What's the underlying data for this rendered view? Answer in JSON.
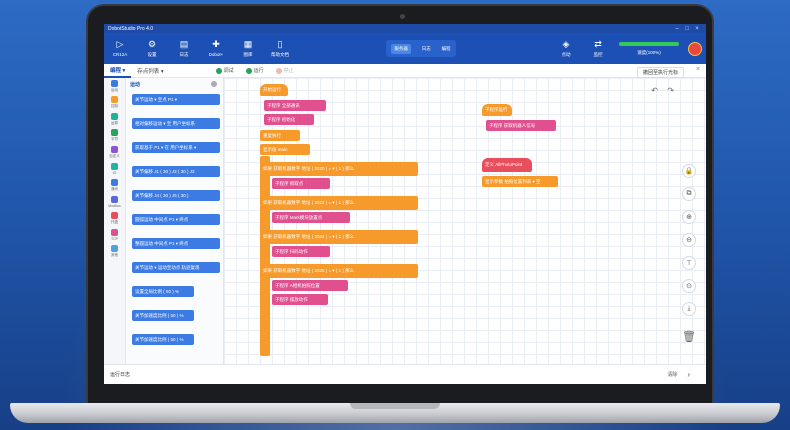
{
  "titlebar": {
    "title": "DobotStudio Pro 4.0",
    "min": "–",
    "max": "□",
    "close": "×"
  },
  "toolbar": {
    "items": [
      {
        "label": "CR12A",
        "icon": "robot-arm-icon",
        "glyph": "▷"
      },
      {
        "label": "设置",
        "icon": "gear-icon",
        "glyph": "⚙"
      },
      {
        "label": "日志",
        "icon": "log-icon",
        "glyph": "▤"
      },
      {
        "label": "Dobot+",
        "icon": "plugin-icon",
        "glyph": "✚"
      },
      {
        "label": "图库",
        "icon": "gallery-icon",
        "glyph": "▦"
      },
      {
        "label": "帮助文档",
        "icon": "document-icon",
        "glyph": "▯"
      }
    ],
    "center": {
      "seg1": "服务器",
      "seg2": "日志",
      "seg3": "编程"
    },
    "right_items": [
      {
        "label": "点动",
        "icon": "jog-icon",
        "glyph": "◈"
      },
      {
        "label": "监控",
        "icon": "monitor-icon",
        "glyph": "⇄"
      }
    ],
    "status": {
      "label": "速度(100%)",
      "speed_fraction": 1.0
    },
    "colors": {
      "bar": "#1d50b5",
      "title": "#1e4aa8"
    }
  },
  "tabs": {
    "items": [
      {
        "label": "编程 ▾",
        "active": true
      },
      {
        "label": "存点列表 ▾",
        "active": false
      }
    ],
    "debug": "调试",
    "run": "运行",
    "stop": "停止",
    "generate": "撤回至执行光标",
    "close": "×"
  },
  "categories": [
    {
      "label": "运动",
      "color": "#3b7be3"
    },
    {
      "label": "控制",
      "color": "#f59a2b"
    },
    {
      "label": "运算",
      "color": "#1fb39a"
    },
    {
      "label": "字符",
      "color": "#27a35b"
    },
    {
      "label": "自定义",
      "color": "#8a56d6"
    },
    {
      "label": "IO",
      "color": "#1fb3a0"
    },
    {
      "label": "通讯",
      "color": "#3b7be3"
    },
    {
      "label": "Modbus",
      "color": "#5a67d8"
    },
    {
      "label": "托盘",
      "color": "#e94e5c"
    },
    {
      "label": "TCP",
      "color": "#e0508e"
    },
    {
      "label": "其他",
      "color": "#4aa3df"
    }
  ],
  "palette": {
    "header": "运动",
    "blocks": [
      {
        "text": "关节运动 ▾  至点  P1 ▾",
        "color": "#3b7be3"
      },
      {
        "text": "相对偏移运动 ▾  至  用户坐标系",
        "color": "#3b7be3"
      },
      {
        "text": "获取基于  P1 ▾  在  用户坐标系 ▾",
        "color": "#3b7be3"
      },
      {
        "text": "关节偏移 J1 ( 30 ) J2 ( 30 ) J3",
        "color": "#3b7be3"
      },
      {
        "text": "关节偏移 J4 ( 30 ) J5 ( 30 )",
        "color": "#3b7be3"
      },
      {
        "text": "圆弧运动 中间点  P1 ▾  终点",
        "color": "#3b7be3"
      },
      {
        "text": "整圆运动 中间点  P1 ▾  终点",
        "color": "#3b7be3"
      },
      {
        "text": "关节运动 ▾  运动至动点 轨迹复现",
        "color": "#3b7be3"
      },
      {
        "text": "设置全局比例 ( 50 ) %",
        "color": "#3b7be3"
      },
      {
        "text": "关节加速度比例 ( 50 ) %",
        "color": "#3b7be3"
      },
      {
        "text": "关节加速度比例 ( 50 ) %",
        "color": "#3b7be3"
      }
    ]
  },
  "canvas": {
    "main": [
      {
        "text": "开始运行",
        "color": "orange"
      },
      {
        "text": "子程序  全部通讯",
        "color": "pink"
      },
      {
        "text": "子程序  初始化",
        "color": "pink"
      },
      {
        "text": "重复执行",
        "color": "orange"
      },
      {
        "text": "显示值 main",
        "color": "orange"
      },
      {
        "text": "如果   获取机器数字 地址 ( 2020 ) = ▾ ( 1 )   那么",
        "color": "orange"
      },
      {
        "text": "子程序  抓取点",
        "color": "pink"
      },
      {
        "text": "如果   获取机器数字 地址 ( 2022 ) = ▾ ( 1 )   那么",
        "color": "orange"
      },
      {
        "text": "子程序  Mark模块放置点",
        "color": "pink"
      },
      {
        "text": "如果   获取机器数字 地址 ( 2024 ) = ▾ ( 1 )   那么",
        "color": "orange"
      },
      {
        "text": "子程序  扫码动作",
        "color": "pink"
      },
      {
        "text": "如果   获取机器数字 地址 ( 2026 ) = ▾ ( 1 )   那么",
        "color": "orange"
      },
      {
        "text": "子程序  A相机拍照位置",
        "color": "pink"
      },
      {
        "text": "子程序  摆放动作",
        "color": "pink"
      }
    ],
    "right": [
      {
        "text": "子程序运行",
        "color": "orange"
      },
      {
        "text": "子程序  获取机器人信号",
        "color": "pink"
      },
      {
        "text": "定义  AllPhotoPoint",
        "color": "red"
      },
      {
        "text": "显示参数  拍照位置列表 ▾ 空",
        "color": "orange"
      }
    ],
    "tools": [
      {
        "icon": "lock-icon",
        "glyph": "🔒"
      },
      {
        "icon": "screenshot-icon",
        "glyph": "⧉"
      },
      {
        "icon": "zoom-in-icon",
        "glyph": "⊕"
      },
      {
        "icon": "zoom-out-icon",
        "glyph": "⊖"
      },
      {
        "icon": "align-top-icon",
        "glyph": "⊤"
      },
      {
        "icon": "center-icon",
        "glyph": "⊙"
      },
      {
        "icon": "download-icon",
        "glyph": "⤓"
      }
    ],
    "undo": "↶",
    "redo": "↷",
    "trash": "🗑"
  },
  "statusbar": {
    "label": "运行日志",
    "clear": "清除",
    "expand": "›"
  }
}
